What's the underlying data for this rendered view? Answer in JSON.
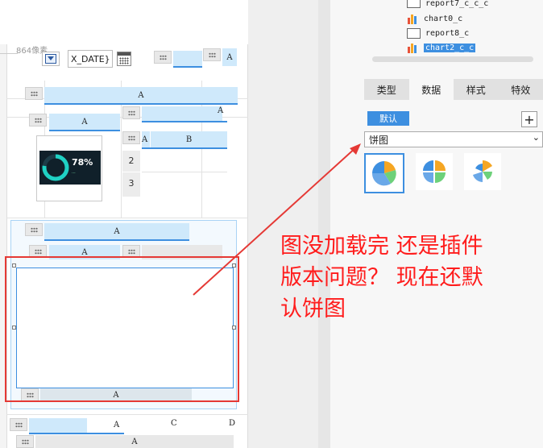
{
  "canvas": {
    "size_label": "864像素",
    "param_text": "X_DATE}",
    "col_a": "A",
    "col_b": "B",
    "col_c": "C",
    "col_d": "D",
    "rows": [
      "2",
      "3"
    ],
    "gauge_percent": "78%",
    "gauge_caption": "..."
  },
  "tree": {
    "items": [
      {
        "label": "report7_c_c_c",
        "type": "report"
      },
      {
        "label": "chart0_c",
        "type": "chart"
      },
      {
        "label": "report8_c",
        "type": "report"
      },
      {
        "label": "chart2_c_c",
        "type": "chart",
        "selected": true
      }
    ]
  },
  "tabs": [
    "类型",
    "数据",
    "样式",
    "特效"
  ],
  "active_tab": "数据",
  "panel": {
    "default_label": "默认",
    "plus_label": "+",
    "select_value": "饼图",
    "select_arrow": "⌄"
  },
  "annotation": {
    "line1": "图没加载完 还是插件",
    "line2": "版本问题？ 现在还默",
    "line3": "认饼图"
  },
  "colors": {
    "accent": "#3d8fe0",
    "highlight": "#cfe9fb",
    "annotation": "#ff1c1c",
    "red_box": "#e53935"
  }
}
